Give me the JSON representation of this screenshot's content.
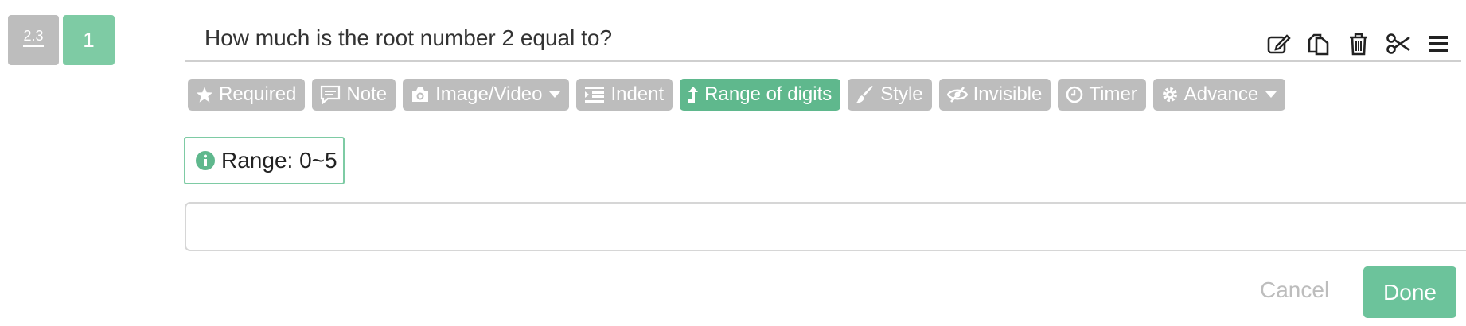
{
  "question": {
    "type_label": "2.3",
    "number": "1",
    "title": "How much is the root number 2 equal to?"
  },
  "tools": [
    "edit-icon",
    "copy-icon",
    "delete-icon",
    "cut-icon",
    "menu-icon"
  ],
  "toolbar": {
    "required": "Required",
    "note": "Note",
    "image_video": "Image/Video",
    "indent": "Indent",
    "range_of_digits": "Range of digits",
    "style": "Style",
    "invisible": "Invisible",
    "timer": "Timer",
    "advance": "Advance"
  },
  "range_info": "Range: 0~5",
  "answer": {
    "value": "",
    "placeholder": ""
  },
  "actions": {
    "cancel": "Cancel",
    "done": "Done"
  },
  "colors": {
    "accent": "#5fb88d",
    "chip": "#bdbdbd",
    "light_accent": "#7ecba4"
  }
}
